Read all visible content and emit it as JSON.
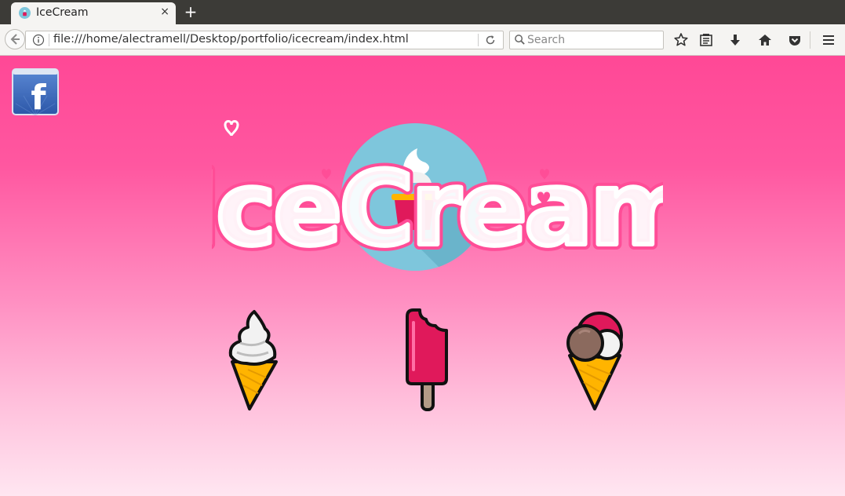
{
  "browser": {
    "tab": {
      "title": "IceCream",
      "close_label": "×",
      "favicon": "icecream-favicon"
    },
    "new_tab_label": "+",
    "url": "file:///home/alectramell/Desktop/portfolio/icecream/index.html",
    "search": {
      "placeholder": "Search"
    },
    "toolbar_icons": [
      "back-icon",
      "info-icon",
      "reload-icon",
      "search-icon",
      "bookmark-star-icon",
      "reader-list-icon",
      "download-icon",
      "home-icon",
      "pocket-icon",
      "menu-icon"
    ]
  },
  "page": {
    "social": {
      "icon": "facebook-icon",
      "label": "f"
    },
    "logo": {
      "text": "IceCream",
      "badge_color": "#7ec6dc"
    },
    "treats": [
      {
        "name": "soft-serve-cone"
      },
      {
        "name": "popsicle"
      },
      {
        "name": "scoop-cone"
      }
    ],
    "colors": {
      "background_top": "#ff4896",
      "background_bottom": "#ffe6f1",
      "accent": "#e0195b",
      "cone": "#ffb400",
      "scoop_brown": "#8b6a5e"
    }
  }
}
